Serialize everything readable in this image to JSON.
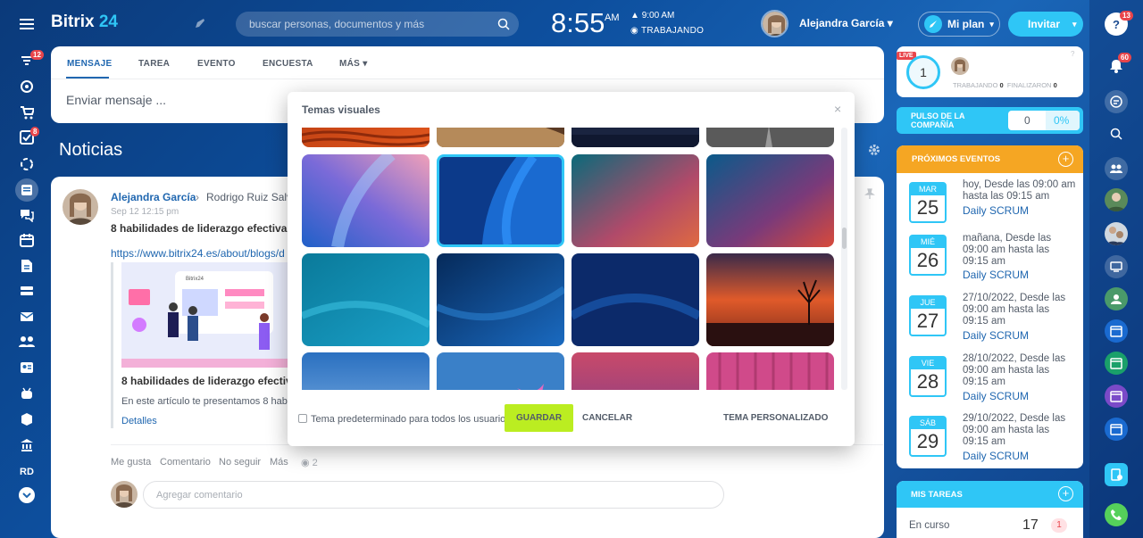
{
  "app": {
    "logo_main": "Bitrix",
    "logo_num": "24"
  },
  "left_rail": {
    "badge_feed": "12",
    "badge_tasks": "8",
    "initials": "RD"
  },
  "header": {
    "search_placeholder": "buscar personas, documentos y más",
    "clock": "8:55",
    "ampm": "AM",
    "alarm_time": "9:00 AM",
    "work_status": "TRABAJANDO",
    "user_name": "Alejandra García",
    "plan_label": "Mi plan",
    "invite_label": "Invitar"
  },
  "composer": {
    "tabs": [
      "MENSAJE",
      "TAREA",
      "EVENTO",
      "ENCUESTA",
      "MÁS"
    ],
    "placeholder": "Enviar mensaje ..."
  },
  "news": {
    "title": "Noticias"
  },
  "post": {
    "author": "Alejandra García",
    "recipient": "Rodrigo Ruiz Salva",
    "date": "Sep 12 12:15 pm",
    "title": "8 habilidades de liderazgo efectivas",
    "link": "https://www.bitrix24.es/about/blogs/d",
    "preview_title": "8 habilidades de liderazgo efectiv",
    "preview_text": "En este artículo te presentamos 8 habi",
    "details": "Detalles",
    "image_brand": "Bitrix24",
    "actions": [
      "Me gusta",
      "Comentario",
      "No seguir",
      "Más"
    ],
    "views": "2",
    "comment_placeholder": "Agregar comentario"
  },
  "dialog": {
    "title": "Temas visuales",
    "checkbox_label": "Tema predeterminado para todos los usuarios",
    "save": "GUARDAR",
    "cancel": "CANCELAR",
    "custom": "TEMA PERSONALIZADO",
    "close": "×"
  },
  "pulse": {
    "live": "LIVE",
    "count": "1",
    "working_label": "TRABAJANDO",
    "working": "0",
    "finished_label": "FINALIZARON",
    "finished": "0",
    "company_pulse_line1": "PULSO DE LA",
    "company_pulse_line2": "COMPAÑÍA",
    "pulse_value": "0",
    "pulse_percent": "0%"
  },
  "events": {
    "title": "PRÓXIMOS EVENTOS",
    "items": [
      {
        "month": "MAR",
        "day": "25",
        "l1": "hoy, Desde las 09:00 am",
        "l2": "hasta las 09:15 am",
        "l3": "",
        "name": "Daily SCRUM"
      },
      {
        "month": "MIÉ",
        "day": "26",
        "l1": "mañana, Desde las",
        "l2": "09:00 am hasta las",
        "l3": "09:15 am",
        "name": "Daily SCRUM"
      },
      {
        "month": "JUE",
        "day": "27",
        "l1": "27/10/2022, Desde las",
        "l2": "09:00 am hasta las",
        "l3": "09:15 am",
        "name": "Daily SCRUM"
      },
      {
        "month": "VIE",
        "day": "28",
        "l1": "28/10/2022, Desde las",
        "l2": "09:00 am hasta las",
        "l3": "09:15 am",
        "name": "Daily SCRUM"
      },
      {
        "month": "SÁB",
        "day": "29",
        "l1": "29/10/2022, Desde las",
        "l2": "09:00 am hasta las",
        "l3": "09:15 am",
        "name": "Daily SCRUM"
      }
    ]
  },
  "tasks": {
    "title": "MIS TAREAS",
    "in_progress_label": "En curso",
    "in_progress": "17",
    "badge": "1"
  },
  "right_rail": {
    "badge_help": "13",
    "badge_notif": "60"
  }
}
